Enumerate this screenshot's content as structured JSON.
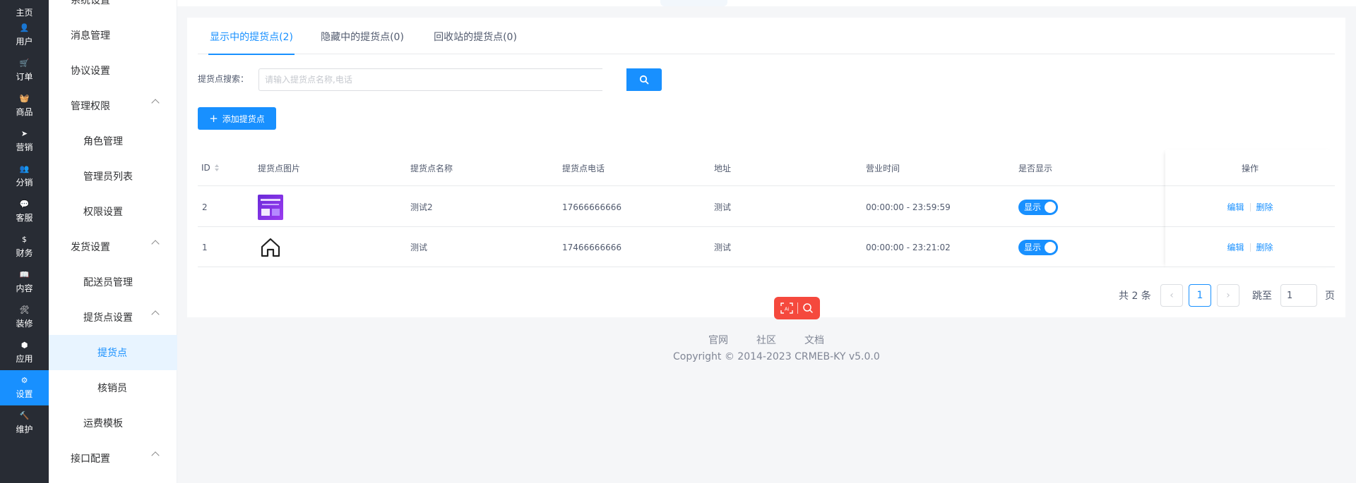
{
  "rail": {
    "items": [
      {
        "label": "主页",
        "icon": "home-icon",
        "glyph": ""
      },
      {
        "label": "用户",
        "icon": "user-icon",
        "glyph": "👤"
      },
      {
        "label": "订单",
        "icon": "cart-icon",
        "glyph": "🛒"
      },
      {
        "label": "商品",
        "icon": "basket-icon",
        "glyph": "🧺"
      },
      {
        "label": "营销",
        "icon": "paper-plane-icon",
        "glyph": "➤"
      },
      {
        "label": "分销",
        "icon": "team-icon",
        "glyph": "👥"
      },
      {
        "label": "客服",
        "icon": "chat-icon",
        "glyph": "💬"
      },
      {
        "label": "财务",
        "icon": "dollar-icon",
        "glyph": "$"
      },
      {
        "label": "内容",
        "icon": "book-icon",
        "glyph": "📖"
      },
      {
        "label": "装修",
        "icon": "tools-icon",
        "glyph": "🛠"
      },
      {
        "label": "应用",
        "icon": "cube-icon",
        "glyph": "⬢"
      },
      {
        "label": "设置",
        "icon": "gear-icon",
        "glyph": "⚙"
      },
      {
        "label": "维护",
        "icon": "hammer-icon",
        "glyph": "🔨"
      }
    ],
    "active_index": 11
  },
  "menu": {
    "items": [
      {
        "label": "系统设置",
        "level": 1
      },
      {
        "label": "消息管理",
        "level": 1
      },
      {
        "label": "协议设置",
        "level": 1
      },
      {
        "label": "管理权限",
        "level": 1,
        "expandable": true
      },
      {
        "label": "角色管理",
        "level": 2
      },
      {
        "label": "管理员列表",
        "level": 2
      },
      {
        "label": "权限设置",
        "level": 2
      },
      {
        "label": "发货设置",
        "level": 1,
        "expandable": true
      },
      {
        "label": "配送员管理",
        "level": 2
      },
      {
        "label": "提货点设置",
        "level": 2,
        "expandable": true
      },
      {
        "label": "提货点",
        "level": 3,
        "active": true
      },
      {
        "label": "核销员",
        "level": 3
      },
      {
        "label": "运费模板",
        "level": 2
      },
      {
        "label": "接口配置",
        "level": 1,
        "expandable": true
      }
    ]
  },
  "tabs": [
    {
      "label": "显示中的提货点(2)",
      "active": true
    },
    {
      "label": "隐藏中的提货点(0)",
      "active": false
    },
    {
      "label": "回收站的提货点(0)",
      "active": false
    }
  ],
  "search": {
    "label": "提货点搜索：",
    "placeholder": "请输入提货点名称,电话",
    "value": "",
    "button_icon": "search-icon"
  },
  "add_button": {
    "label": "添加提货点",
    "icon": "plus-icon"
  },
  "table": {
    "columns": [
      "ID",
      "提货点图片",
      "提货点名称",
      "提货点电话",
      "地址",
      "营业时间",
      "是否显示",
      "操作"
    ],
    "rows": [
      {
        "id": "2",
        "image": "promo-thumbnail",
        "name": "测试2",
        "phone": "17666666666",
        "address": "测试",
        "hours": "00:00:00 - 23:59:59",
        "visible": true,
        "toggle_label": "显示",
        "edit": "编辑",
        "delete": "删除"
      },
      {
        "id": "1",
        "image": "house-icon",
        "name": "测试",
        "phone": "17466666666",
        "address": "测试",
        "hours": "00:00:00 - 23:21:02",
        "visible": true,
        "toggle_label": "显示",
        "edit": "编辑",
        "delete": "删除"
      }
    ]
  },
  "pagination": {
    "total_text": "共 2 条",
    "current_page": "1",
    "jump_label": "跳至",
    "jump_value": "1",
    "page_suffix": "页"
  },
  "footer": {
    "links": [
      "官网",
      "社区",
      "文档"
    ],
    "copyright": "Copyright © 2014-2023 CRMEB-KY v5.0.0"
  },
  "colors": {
    "primary": "#1890ff",
    "rail_bg": "#282c34",
    "float_tool": "#f5493d"
  }
}
